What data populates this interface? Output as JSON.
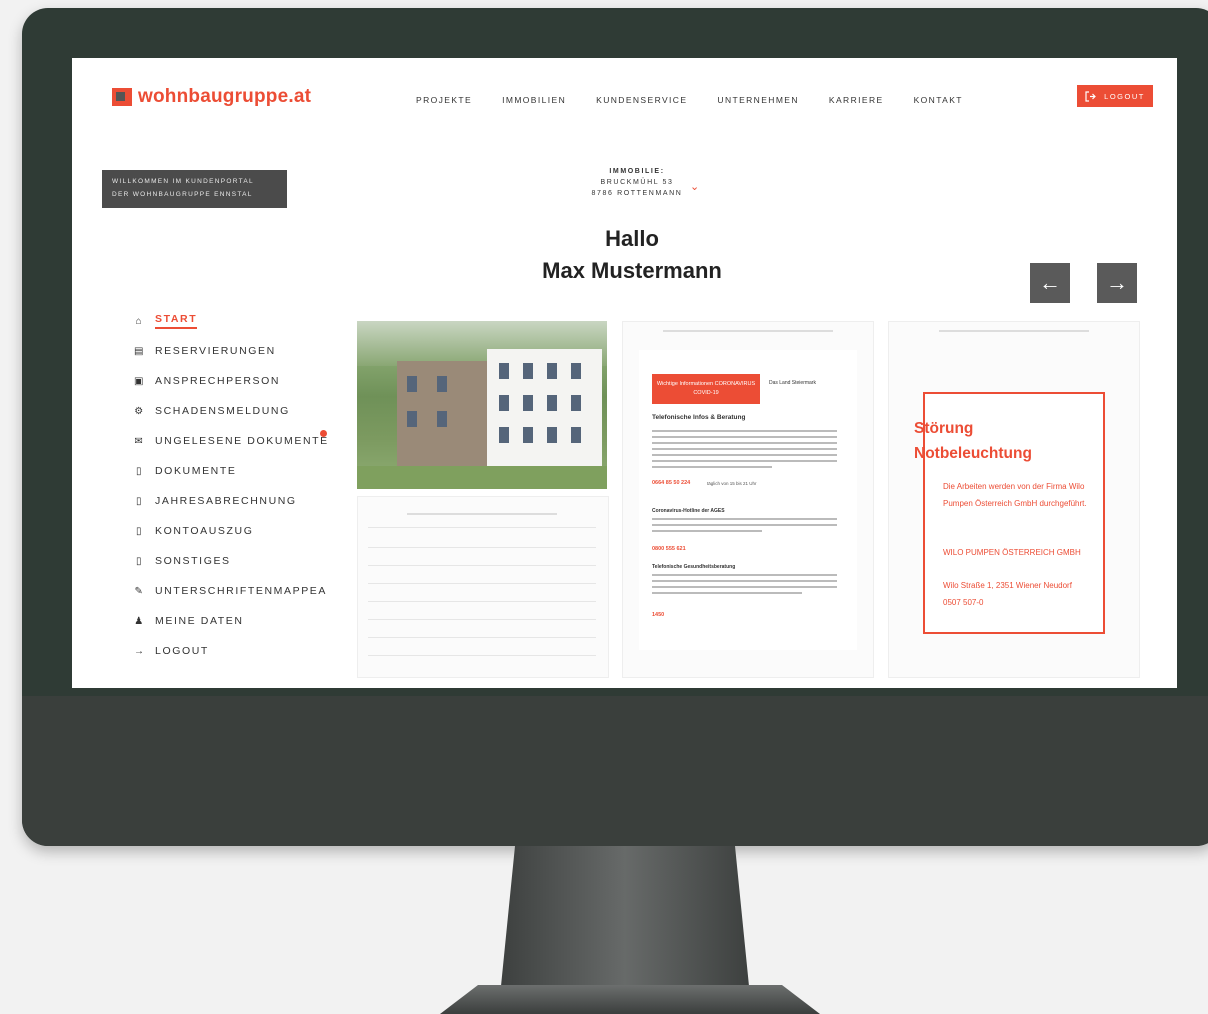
{
  "header": {
    "logo_text": "wohnbaugruppe.at",
    "nav": [
      "PROJEKTE",
      "IMMOBILIEN",
      "KUNDENSERVICE",
      "UNTERNEHMEN",
      "KARRIERE",
      "KONTAKT"
    ],
    "logout_label": "LOGOUT"
  },
  "welcome": {
    "line1": "WILLKOMMEN IM KUNDENPORTAL",
    "line2": "DER WOHNBAUGRUPPE ENNSTAL"
  },
  "property": {
    "label": "IMMOBILIE:",
    "street": "BRUCKMÜHL 53",
    "city": "8786 ROTTENMANN"
  },
  "greeting": {
    "hello": "Hallo",
    "name": "Max Mustermann"
  },
  "sidebar": {
    "items": [
      {
        "label": "START",
        "icon": "home-icon"
      },
      {
        "label": "RESERVIERUNGEN",
        "icon": "document-icon"
      },
      {
        "label": "ANSPRECHPERSON",
        "icon": "chat-icon"
      },
      {
        "label": "SCHADENSMELDUNG",
        "icon": "gear-icon"
      },
      {
        "label": "UNGELESENE DOKUMENTE",
        "icon": "mail-icon"
      },
      {
        "label": "DOKUMENTE",
        "icon": "file-icon"
      },
      {
        "label": "JAHRESABRECHNUNG",
        "icon": "file-icon"
      },
      {
        "label": "KONTOAUSZUG",
        "icon": "file-icon"
      },
      {
        "label": "SONSTIGES",
        "icon": "file-icon"
      },
      {
        "label": "UNTERSCHRIFTENMAPPEA",
        "icon": "pen-icon"
      },
      {
        "label": "MEINE DATEN",
        "icon": "user-icon"
      },
      {
        "label": "LOGOUT",
        "icon": "logout-icon"
      }
    ]
  },
  "cards": {
    "info": {
      "covid_badge": "Wichtige Informationen CORONAVIRUS COVID-19",
      "land": "Das Land Steiermark",
      "title": "Telefonische Infos & Beratung",
      "hotline1": "0664 85 50 224",
      "hotline1_note": "täglich von 15 bis 21 Uhr",
      "ages_title": "Coronavirus-Hotline der AGES",
      "hotline2": "0800 555 621",
      "gesund_title": "Telefonische Gesundheitsberatung",
      "hotline3": "1450"
    },
    "alert": {
      "title_line1": "Störung",
      "title_line2": "Notbeleuchtung",
      "text1": "Die Arbeiten werden von der Firma Wilo Pumpen Österreich GmbH durchgeführt.",
      "company": "WILO PUMPEN ÖSTERREICH GMBH",
      "address": "Wilo Straße 1, 2351 Wiener Neudorf",
      "phone": "0507 507-0"
    }
  },
  "colors": {
    "accent": "#ec4d35",
    "bezel": "#2f3b35",
    "chin": "#3a3f3c"
  }
}
